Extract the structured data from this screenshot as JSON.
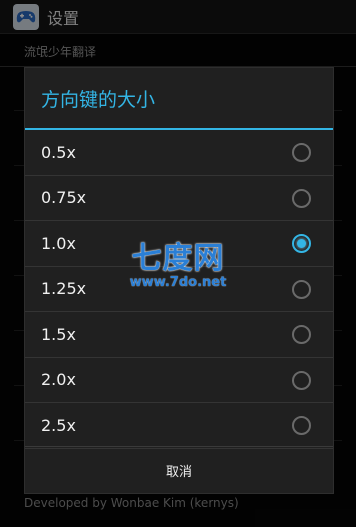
{
  "actionbar": {
    "title": "设置",
    "icon": "gamepad-icon"
  },
  "subheader": {
    "label": "流氓少年翻译"
  },
  "dialog": {
    "title": "方向键的大小",
    "options": [
      {
        "label": "0.5x",
        "checked": false
      },
      {
        "label": "0.75x",
        "checked": false
      },
      {
        "label": "1.0x",
        "checked": true
      },
      {
        "label": "1.25x",
        "checked": false
      },
      {
        "label": "1.5x",
        "checked": false
      },
      {
        "label": "2.0x",
        "checked": false
      },
      {
        "label": "2.5x",
        "checked": false
      }
    ],
    "cancel_label": "取消"
  },
  "footer": {
    "developer": "Developed by Wonbae Kim (kernys)"
  },
  "watermark": {
    "main": "七度网",
    "url": "www.7do.net"
  },
  "colors": {
    "accent": "#33b5e5",
    "dialog_bg": "#202020",
    "watermark": "#2a7fd6"
  }
}
